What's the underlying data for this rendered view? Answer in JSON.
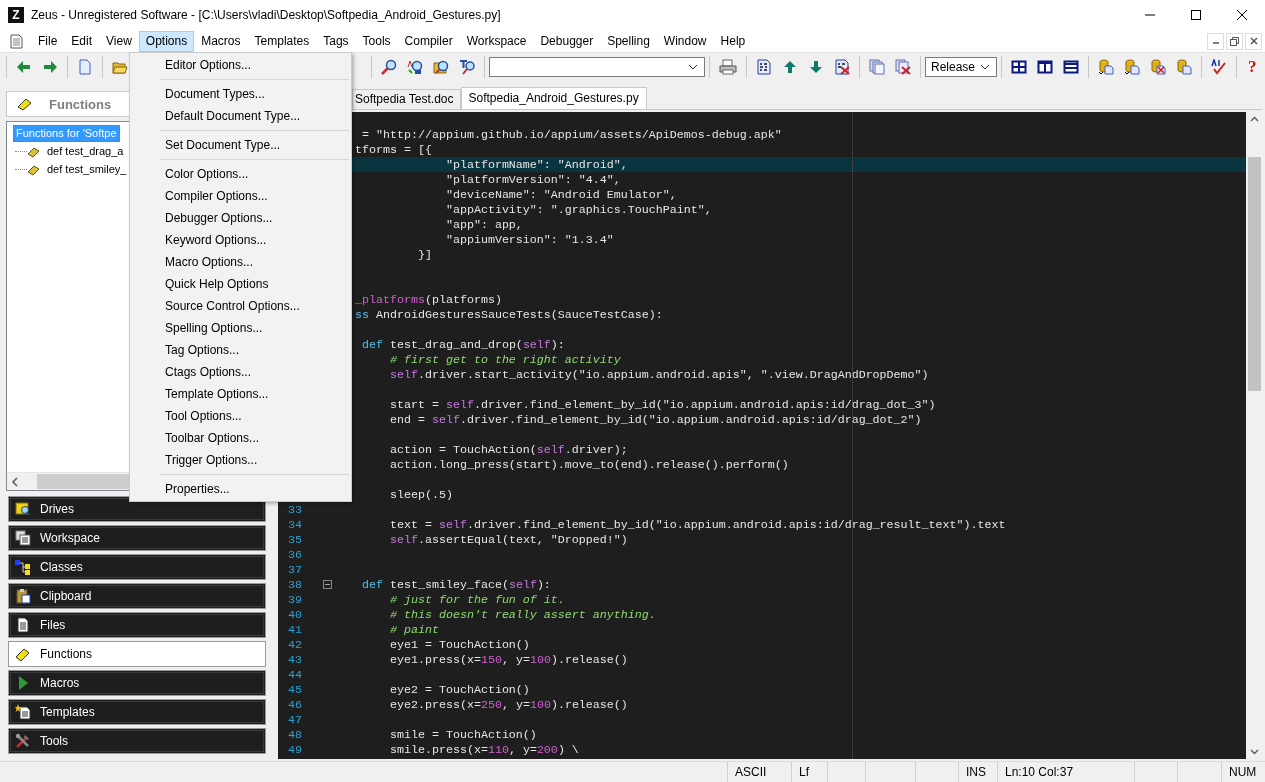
{
  "window": {
    "app_icon": "Z",
    "title": "Zeus - Unregistered Software - [C:\\Users\\vladi\\Desktop\\Softpedia_Android_Gestures.py]"
  },
  "menu_bar": [
    {
      "label": "File",
      "selected": false
    },
    {
      "label": "Edit",
      "selected": false
    },
    {
      "label": "View",
      "selected": false
    },
    {
      "label": "Options",
      "selected": true
    },
    {
      "label": "Macros",
      "selected": false
    },
    {
      "label": "Templates",
      "selected": false
    },
    {
      "label": "Tags",
      "selected": false
    },
    {
      "label": "Tools",
      "selected": false
    },
    {
      "label": "Compiler",
      "selected": false
    },
    {
      "label": "Workspace",
      "selected": false
    },
    {
      "label": "Debugger",
      "selected": false
    },
    {
      "label": "Spelling",
      "selected": false
    },
    {
      "label": "Window",
      "selected": false
    },
    {
      "label": "Help",
      "selected": false
    }
  ],
  "options_menu": {
    "groups": [
      [
        "Editor Options..."
      ],
      [
        "Document Types...",
        "Default Document Type..."
      ],
      [
        "Set Document Type..."
      ],
      [
        "Color Options...",
        "Compiler Options...",
        "Debugger Options...",
        "Keyword Options...",
        "Macro Options...",
        "Quick Help Options",
        "Source Control Options...",
        "Spelling Options...",
        "Tag Options...",
        "Ctags Options...",
        "Template Options...",
        "Tool Options...",
        "Toolbar Options...",
        "Trigger Options..."
      ],
      [
        "Properties..."
      ]
    ]
  },
  "toolbar": {
    "configuration": "Release",
    "help": "?"
  },
  "side_panel": {
    "title": "Functions",
    "tree": [
      {
        "label": "Functions for 'Softpe",
        "selected": true,
        "children": [
          {
            "label": "def test_drag_a",
            "selected": false
          },
          {
            "label": "def test_smiley_",
            "selected": false
          }
        ]
      }
    ],
    "tabs": [
      {
        "label": "Drives",
        "selected": false
      },
      {
        "label": "Workspace",
        "selected": false
      },
      {
        "label": "Classes",
        "selected": false
      },
      {
        "label": "Clipboard",
        "selected": false
      },
      {
        "label": "Files",
        "selected": false
      },
      {
        "label": "Functions",
        "selected": true
      },
      {
        "label": "Macros",
        "selected": false
      },
      {
        "label": "Templates",
        "selected": false
      },
      {
        "label": "Tools",
        "selected": false
      }
    ]
  },
  "editor": {
    "tabs": [
      {
        "label": "Softpedia Test.doc",
        "selected": false
      },
      {
        "label": "Softpedia_Android_Gestures.py",
        "selected": true
      }
    ],
    "lines": [
      {
        "current": false,
        "fold": false,
        "tokens": [
          {
            "text": "    = \"http://appium.github.io/appium/assets/ApiDemos-debug.apk\"",
            "kind": "plain"
          }
        ]
      },
      {
        "current": false,
        "fold": false,
        "tokens": [
          {
            "text": "   tforms = [{",
            "kind": "plain"
          }
        ]
      },
      {
        "current": true,
        "fold": false,
        "tokens": [
          {
            "text": "                \"platformName\": \"Android\",",
            "kind": "plain"
          }
        ]
      },
      {
        "current": false,
        "fold": false,
        "tokens": [
          {
            "text": "                \"platformVersion\": \"4.4\",",
            "kind": "plain"
          }
        ]
      },
      {
        "current": false,
        "fold": false,
        "tokens": [
          {
            "text": "                \"deviceName\": \"Android Emulator\",",
            "kind": "plain"
          }
        ]
      },
      {
        "current": false,
        "fold": false,
        "tokens": [
          {
            "text": "                \"appActivity\": \".graphics.TouchPaint\",",
            "kind": "plain"
          }
        ]
      },
      {
        "current": false,
        "fold": false,
        "tokens": [
          {
            "text": "                \"app\": app,",
            "kind": "plain"
          }
        ]
      },
      {
        "current": false,
        "fold": false,
        "tokens": [
          {
            "text": "                \"appiumVersion\": \"1.3.4\"",
            "kind": "plain"
          }
        ]
      },
      {
        "current": false,
        "fold": false,
        "tokens": [
          {
            "text": "            }]",
            "kind": "plain"
          }
        ]
      },
      {
        "current": false,
        "fold": false
      },
      {
        "current": false,
        "fold": false
      },
      {
        "current": false,
        "fold": false,
        "tokens": [
          {
            "text": "   _platforms",
            "kind": "decorator"
          },
          {
            "text": "(platforms)",
            "kind": "plain"
          }
        ]
      },
      {
        "current": false,
        "fold": false,
        "tokens": [
          {
            "text": "   ss",
            "kind": "keyword"
          },
          {
            "text": " AndroidGesturesSauceTests(SauceTestCase):",
            "kind": "plain"
          }
        ]
      },
      {
        "current": false,
        "fold": false
      },
      {
        "current": false,
        "fold": false,
        "tokens": [
          {
            "text": "    def",
            "kind": "keyword"
          },
          {
            "text": " test_drag_and_drop(",
            "kind": "plain"
          },
          {
            "text": "self",
            "kind": "self"
          },
          {
            "text": "):",
            "kind": "plain"
          }
        ]
      },
      {
        "current": false,
        "fold": false,
        "tokens": [
          {
            "text": "        # first get to the right activity",
            "kind": "comment"
          }
        ]
      },
      {
        "current": false,
        "fold": false,
        "tokens": [
          {
            "text": "        self",
            "kind": "self"
          },
          {
            "text": ".driver.start_activity(\"io.appium.android.apis\", \".view.DragAndDropDemo\")",
            "kind": "plain"
          }
        ]
      },
      {
        "current": false,
        "fold": false
      },
      {
        "current": false,
        "fold": false,
        "tokens": [
          {
            "text": "        start = ",
            "kind": "plain"
          },
          {
            "text": "self",
            "kind": "self"
          },
          {
            "text": ".driver.find_element_by_id(\"io.appium.android.apis:id/drag_dot_3\")",
            "kind": "plain"
          }
        ]
      },
      {
        "current": false,
        "fold": false,
        "tokens": [
          {
            "text": "        end = ",
            "kind": "plain"
          },
          {
            "text": "self",
            "kind": "self"
          },
          {
            "text": ".driver.find_element_by_id(\"io.appium.android.apis:id/drag_dot_2\")",
            "kind": "plain"
          }
        ]
      },
      {
        "current": false,
        "fold": false
      },
      {
        "current": false,
        "fold": false,
        "tokens": [
          {
            "text": "        action = TouchAction(",
            "kind": "plain"
          },
          {
            "text": "self",
            "kind": "self"
          },
          {
            "text": ".driver);",
            "kind": "plain"
          }
        ]
      },
      {
        "current": false,
        "fold": false,
        "tokens": [
          {
            "text": "        action.long_press(start).move_to(end).release().perform()",
            "kind": "plain"
          }
        ]
      },
      {
        "current": false,
        "fold": false
      },
      {
        "current": false,
        "fold": false,
        "tokens": [
          {
            "text": "        sleep(.5)",
            "kind": "plain"
          }
        ]
      },
      {
        "number": "33",
        "current": false,
        "fold": false
      },
      {
        "number": "34",
        "current": false,
        "fold": false,
        "tokens": [
          {
            "text": "        text = ",
            "kind": "plain"
          },
          {
            "text": "self",
            "kind": "self"
          },
          {
            "text": ".driver.find_element_by_id(\"io.appium.android.apis:id/drag_result_text\").text",
            "kind": "plain"
          }
        ]
      },
      {
        "number": "35",
        "current": false,
        "fold": false,
        "tokens": [
          {
            "text": "        self",
            "kind": "self"
          },
          {
            "text": ".assertEqual(text, \"Dropped!\")",
            "kind": "plain"
          }
        ]
      },
      {
        "number": "36",
        "current": false,
        "fold": false
      },
      {
        "number": "37",
        "current": false,
        "fold": false
      },
      {
        "number": "38",
        "current": false,
        "fold": true,
        "tokens": [
          {
            "text": "    def",
            "kind": "keyword"
          },
          {
            "text": " test_smiley_face(",
            "kind": "plain"
          },
          {
            "text": "self",
            "kind": "self"
          },
          {
            "text": "):",
            "kind": "plain"
          }
        ]
      },
      {
        "number": "39",
        "current": false,
        "fold": false,
        "tokens": [
          {
            "text": "        # just for the fun of it.",
            "kind": "comment"
          }
        ]
      },
      {
        "number": "40",
        "current": false,
        "fold": false,
        "tokens": [
          {
            "text": "        # this doesn't really assert anything.",
            "kind": "comment"
          }
        ]
      },
      {
        "number": "41",
        "current": false,
        "fold": false,
        "tokens": [
          {
            "text": "        # paint",
            "kind": "comment"
          }
        ]
      },
      {
        "number": "42",
        "current": false,
        "fold": false,
        "tokens": [
          {
            "text": "        eye1 = TouchAction()",
            "kind": "plain"
          }
        ]
      },
      {
        "number": "43",
        "current": false,
        "fold": false,
        "tokens": [
          {
            "text": "        eye1.press(x=",
            "kind": "plain"
          },
          {
            "text": "150",
            "kind": "number"
          },
          {
            "text": ", y=",
            "kind": "plain"
          },
          {
            "text": "100",
            "kind": "number"
          },
          {
            "text": ").release()",
            "kind": "plain"
          }
        ]
      },
      {
        "number": "44",
        "current": false,
        "fold": false
      },
      {
        "number": "45",
        "current": false,
        "fold": false,
        "tokens": [
          {
            "text": "        eye2 = TouchAction()",
            "kind": "plain"
          }
        ]
      },
      {
        "number": "46",
        "current": false,
        "fold": false,
        "tokens": [
          {
            "text": "        eye2.press(x=",
            "kind": "plain"
          },
          {
            "text": "250",
            "kind": "number"
          },
          {
            "text": ", y=",
            "kind": "plain"
          },
          {
            "text": "100",
            "kind": "number"
          },
          {
            "text": ").release()",
            "kind": "plain"
          }
        ]
      },
      {
        "number": "47",
        "current": false,
        "fold": false
      },
      {
        "number": "48",
        "current": false,
        "fold": false,
        "tokens": [
          {
            "text": "        smile = TouchAction()",
            "kind": "plain"
          }
        ]
      },
      {
        "number": "49",
        "current": false,
        "fold": false,
        "tokens": [
          {
            "text": "        smile.press(x=",
            "kind": "plain"
          },
          {
            "text": "110",
            "kind": "number"
          },
          {
            "text": ", y=",
            "kind": "plain"
          },
          {
            "text": "200",
            "kind": "number"
          },
          {
            "text": ") \\",
            "kind": "plain"
          }
        ]
      }
    ]
  },
  "status_bar": {
    "encoding": "ASCII",
    "line_ending": "Lf",
    "mode": "INS",
    "position": "Ln:10 Col:37",
    "num_lock": "NUM"
  }
}
